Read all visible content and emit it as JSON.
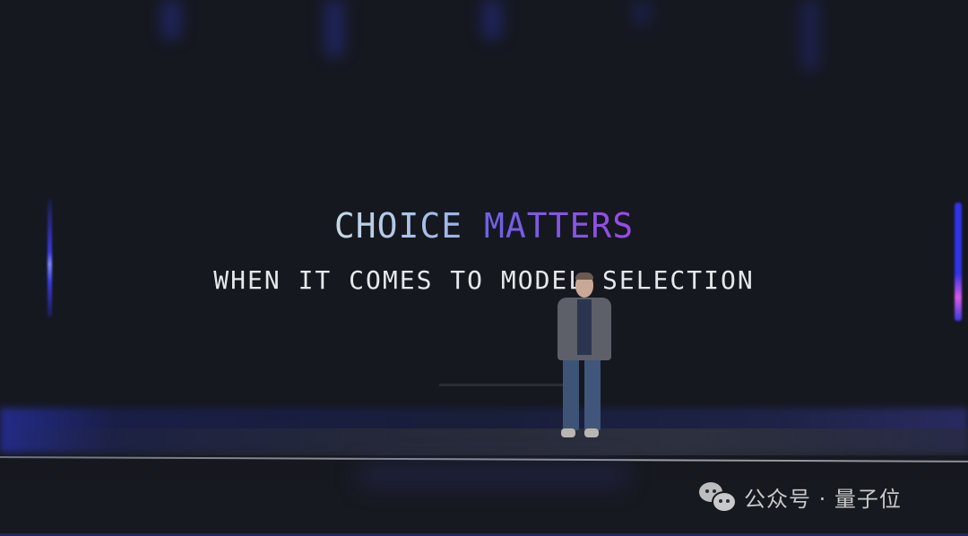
{
  "slide": {
    "headline_word1": "CHOICE",
    "headline_word2": "MATTERS",
    "subline": "WHEN IT COMES TO MODEL SELECTION"
  },
  "colors": {
    "headline_word1_gradient": [
      "#c6dbe6",
      "#9ab2ea"
    ],
    "headline_word2_gradient": [
      "#6e62e4",
      "#9a4ae6"
    ],
    "subline": "#e6e8ec",
    "background": "#15181e",
    "stage_light_blue": "#3232e6",
    "stage_light_pink": "#d55be8"
  },
  "watermark": {
    "icon": "wechat-icon",
    "text": "公众号 · 量子位"
  }
}
